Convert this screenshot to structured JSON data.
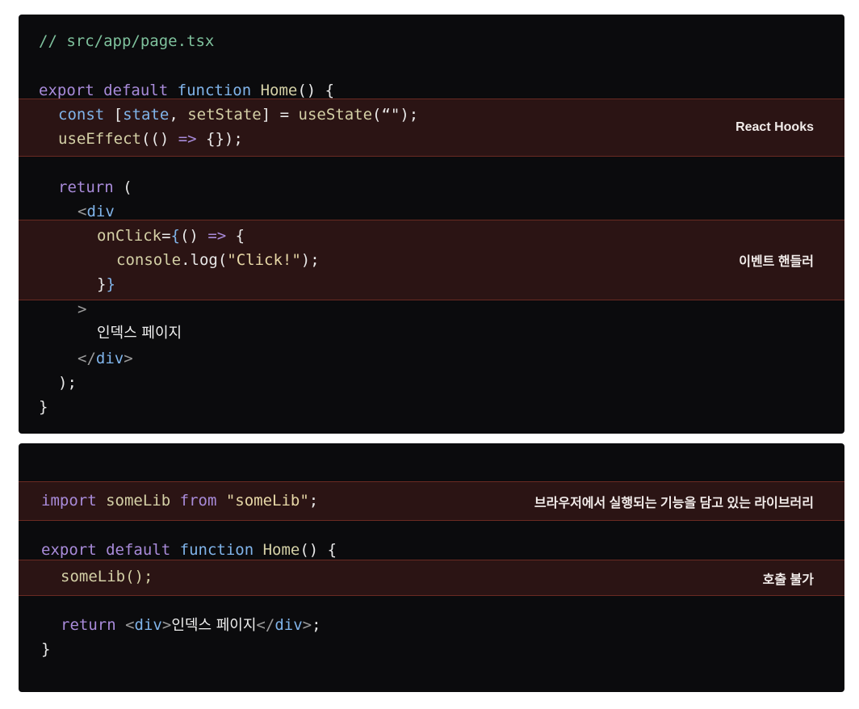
{
  "panel1": {
    "comment": "// src/app/page.tsx",
    "l2": {
      "export": "export",
      "default": "default",
      "function": "function",
      "name": "Home",
      "rest": "() {"
    },
    "l3": {
      "const": "const",
      "lb": "[",
      "state": "state",
      "comma": ", ",
      "setState": "setState",
      "rb": "]",
      "eq": " = ",
      "useState": "useState",
      "args": "(“\");"
    },
    "l4": {
      "useEffect": "useEffect",
      "open": "(() ",
      "arrow": "=>",
      "rest": " {});"
    },
    "l5": {
      "return": "return",
      "rest": " ("
    },
    "l6": {
      "open": "<",
      "tag": "div"
    },
    "l7": {
      "attr": "onClick",
      "eq": "=",
      "brace": "{",
      "rest": "() ",
      "arrow": "=>",
      "end": " {"
    },
    "l8": {
      "console": "console",
      "dot": ".log(",
      "str": "\"Click!\"",
      "end": ");"
    },
    "l9": {
      "a": "}",
      "b": "}"
    },
    "l10": ">",
    "l11": "인덱스 페이지",
    "l12": {
      "open": "</",
      "tag": "div",
      "close": ">"
    },
    "l13": ");",
    "l14": "}",
    "label_hooks": "React Hooks",
    "label_event": "이벤트 핸들러"
  },
  "panel2": {
    "l1": {
      "import": "import",
      "name": "someLib",
      "from": "from",
      "str": "\"someLib\"",
      "end": ";"
    },
    "l2": {
      "export": "export",
      "default": "default",
      "function": "function",
      "name": "Home",
      "rest": "() {"
    },
    "l3": "someLib();",
    "l4": {
      "return": "return",
      "open": "<",
      "tag": "div",
      "mid": ">",
      "text": "인덱스 페이지",
      "close_open": "</",
      "close_tag": "div",
      "close": ">",
      "end": ";"
    },
    "l5": "}",
    "label_lib": "브라우저에서 실행되는 기능을 담고 있는 라이브러리",
    "label_call": "호출 불가"
  },
  "colors": {
    "keyword": "#a98bda",
    "function": "#d4d0a6",
    "blue": "#80b4ea",
    "string": "#e7d8a7",
    "comment": "#7fc29d",
    "highlight_bg": "#2b1414",
    "highlight_border": "#6a2a22"
  }
}
